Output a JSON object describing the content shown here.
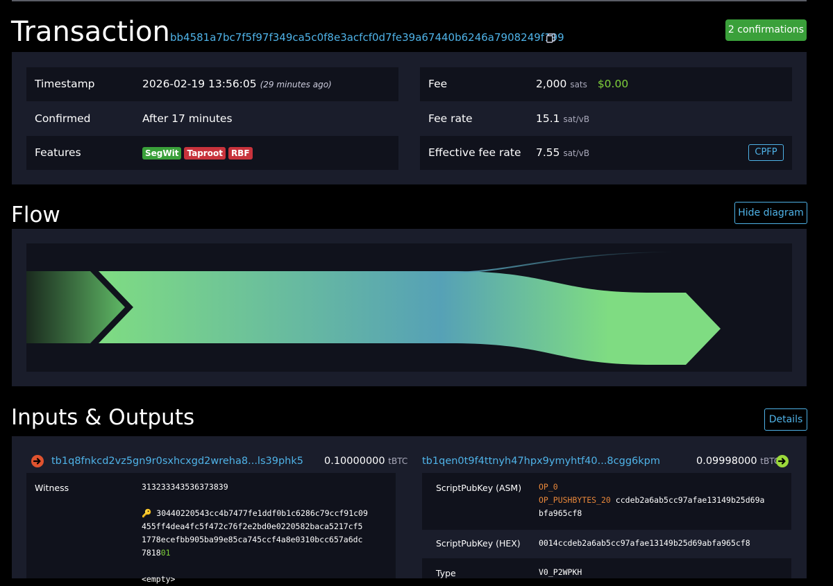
{
  "header": {
    "title": "Transaction",
    "txid": "bb4581a7bc7f5f97f349ca5c0f8e3acfcf0d7fe39a67440b6246a7908249f199",
    "confirmations": "2 confirmations"
  },
  "details": {
    "timestamp_label": "Timestamp",
    "timestamp_value": "2026-02-19 13:56:05",
    "timestamp_ago": "(29 minutes ago)",
    "confirmed_label": "Confirmed",
    "confirmed_value": "After 17 minutes",
    "features_label": "Features",
    "features": [
      "SegWit",
      "Taproot",
      "RBF"
    ],
    "fee_label": "Fee",
    "fee_value": "2,000",
    "fee_unit": "sats",
    "fee_usd": "$0.00",
    "feerate_label": "Fee rate",
    "feerate_value": "15.1",
    "feerate_unit": "sat/vB",
    "eff_label": "Effective fee rate",
    "eff_value": "7.55",
    "eff_unit": "sat/vB",
    "cpfp": "CPFP"
  },
  "flow": {
    "title": "Flow",
    "hide_button": "Hide diagram"
  },
  "io": {
    "title": "Inputs & Outputs",
    "details_button": "Details",
    "input": {
      "address": "tb1q8fnkcd2vz5gn9r0sxhcxgd2wreha8...ls39phk5",
      "amount": "0.10000000",
      "unit": "tBTC",
      "witness_label": "Witness",
      "witness_1": "313233343536373839",
      "witness_2a": "30440220543cc4b7477fe1ddf0b1c6286c79ccf91c09",
      "witness_2b": "455ff4dea4fc5f472c76f2e2bd0e0220582baca5217cf5",
      "witness_2c": "1778ecefbb905ba99e85ca745ccf4a8e0310bcc657a6dc",
      "witness_2d": "7818",
      "witness_2e": "01",
      "witness_3": "<empty>"
    },
    "output": {
      "address": "tb1qen0t9f4ttnyh47hpx9ymyhtf40...8cgg6kpm",
      "amount": "0.09998000",
      "unit": "tBTC",
      "asm_label": "ScriptPubKey (ASM)",
      "asm_op0": "OP_0",
      "asm_push": "OP_PUSHBYTES_20",
      "asm_data_a": "ccdeb2a6ab5cc97afae13149b25d69a",
      "asm_data_b": "bfa965cf8",
      "hex_label": "ScriptPubKey (HEX)",
      "hex_value": "0014ccdeb2a6ab5cc97afae13149b25d69abfa965cf8",
      "type_label": "Type",
      "type_value": "V0_P2WPKH"
    }
  },
  "colors": {
    "accent": "#4fb3e8",
    "confirm_green": "#3aa03a",
    "flow_green": "#7fdc82",
    "flow_blue": "#56a1b6",
    "input_icon": "#e0532f",
    "output_icon": "#9bd93b"
  }
}
